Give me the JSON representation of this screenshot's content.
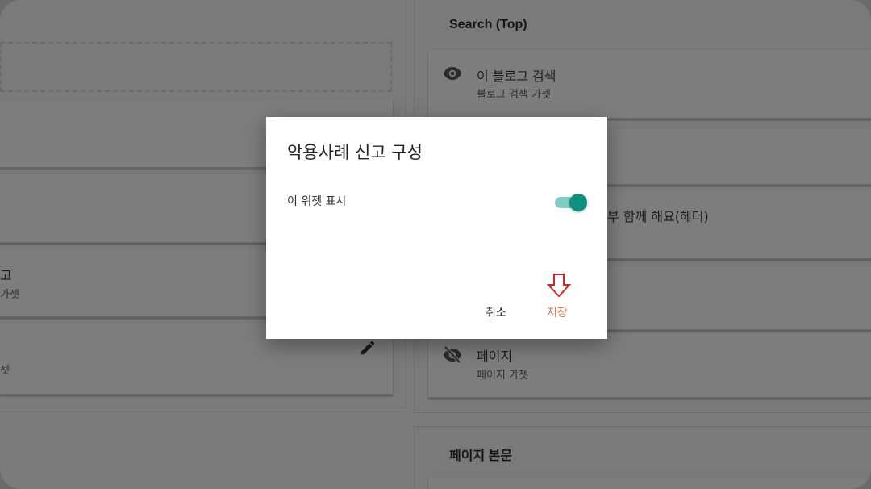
{
  "left_column": {
    "card3_title": "고",
    "card3_sub": "가젯",
    "card4_sub": "젯"
  },
  "right_column": {
    "search_section_title": "Search (Top)",
    "search_widget": {
      "title": "이 블로그 검색",
      "sub": "블로그 검색 가젯",
      "icon": "eye-icon"
    },
    "header_widget": {
      "title": "부 함께 해요(헤더)"
    },
    "pages_widget": {
      "title": "페이지",
      "sub": "페이지 가젯",
      "icon": "eye-off-icon"
    },
    "body_section_title": "페이지 본문"
  },
  "dialog": {
    "title": "악용사례 신고 구성",
    "toggle_label": "이 위젯 표시",
    "toggle_on": true,
    "cancel_label": "취소",
    "save_label": "저장",
    "accent_color": "#0f8f7f",
    "save_color": "#d87a4f",
    "annotation_icon": "down-arrow-icon"
  }
}
